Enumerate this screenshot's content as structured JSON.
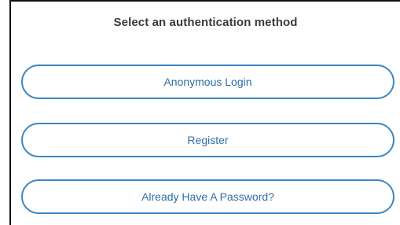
{
  "auth": {
    "title": "Select an authentication method",
    "buttons": {
      "anonymous": "Anonymous Login",
      "register": "Register",
      "password": "Already Have A Password?"
    }
  },
  "colors": {
    "button_border": "#3a86c4",
    "button_text": "#2f6ea8",
    "title_text": "#3a3a3a"
  }
}
